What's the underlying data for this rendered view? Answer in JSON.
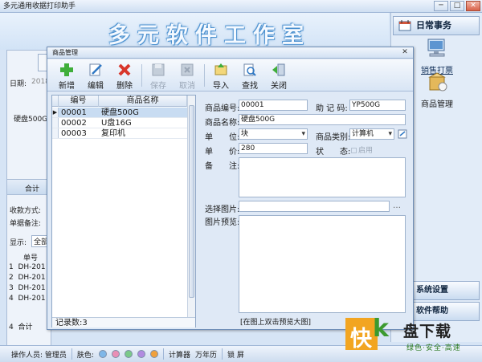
{
  "window": {
    "title": "多元通用收据打印助手",
    "minimize": "─",
    "maximize": "□",
    "close": "✕"
  },
  "banner": {
    "title": "多元软件工作室"
  },
  "left": {
    "date_label": "日期:",
    "date_value": "2018",
    "product": "硬盘500G",
    "total_label": "合计",
    "payment_label": "收款方式:",
    "note_label": "单据备注:",
    "show_label": "显示:",
    "show_value": "全部",
    "col_no": "单号",
    "rows": [
      {
        "idx": "1",
        "no": "DH-201"
      },
      {
        "idx": "2",
        "no": "DH-201"
      },
      {
        "idx": "3",
        "no": "DH-201"
      },
      {
        "idx": "4",
        "no": "DH-201"
      }
    ],
    "footer_idx": "4",
    "footer_total": "合计"
  },
  "nav": {
    "header": "日常事务",
    "items": [
      {
        "label": "销售打票"
      },
      {
        "label": "商品管理"
      }
    ],
    "settings": "系统设置",
    "help": "软件帮助"
  },
  "dialog": {
    "title": "商品管理",
    "close": "✕",
    "toolbar": {
      "add": "新增",
      "edit": "编辑",
      "delete": "删除",
      "save": "保存",
      "cancel": "取消",
      "import": "导入",
      "find": "查找",
      "close": "关闭"
    },
    "grid": {
      "headers": [
        "编号",
        "商品名称"
      ],
      "rows": [
        {
          "marker": "▶",
          "code": "00001",
          "name": "硬盘500G"
        },
        {
          "marker": "",
          "code": "00002",
          "name": "U盘16G"
        },
        {
          "marker": "",
          "code": "00003",
          "name": "复印机"
        }
      ],
      "footer": "记录数:3"
    },
    "form": {
      "code_label": "商品编号:",
      "code_value": "00001",
      "mnemonic_label": "助 记 码:",
      "mnemonic_value": "YP500G",
      "name_label": "商品名称:",
      "name_value": "硬盘500G",
      "unit_label": "单　　位:",
      "unit_value": "块",
      "category_label": "商品类别:",
      "category_value": "计算机",
      "price_label": "单　　价:",
      "price_value": "280",
      "status_label": "状　　态:",
      "status_option": "启用",
      "remark_label": "备　　注:",
      "image_label": "选择图片:",
      "image_browse": "…",
      "preview_label": "图片预览:",
      "preview_hint": "[在图上双击预览大图]"
    }
  },
  "statusbar": {
    "operator": "操作人员: 管理员",
    "skin_label": "肤色:",
    "skin_colors": [
      "#7fb7e8",
      "#e98fb5",
      "#7bc98a",
      "#b18be0",
      "#f0a03c"
    ],
    "calculator": "计算器",
    "calendar": "万年历",
    "lock": "锁 屏"
  },
  "watermark": {
    "box": "快",
    "k": "k",
    "main": "盘下载",
    "sub": "绿色·安全·高速"
  }
}
